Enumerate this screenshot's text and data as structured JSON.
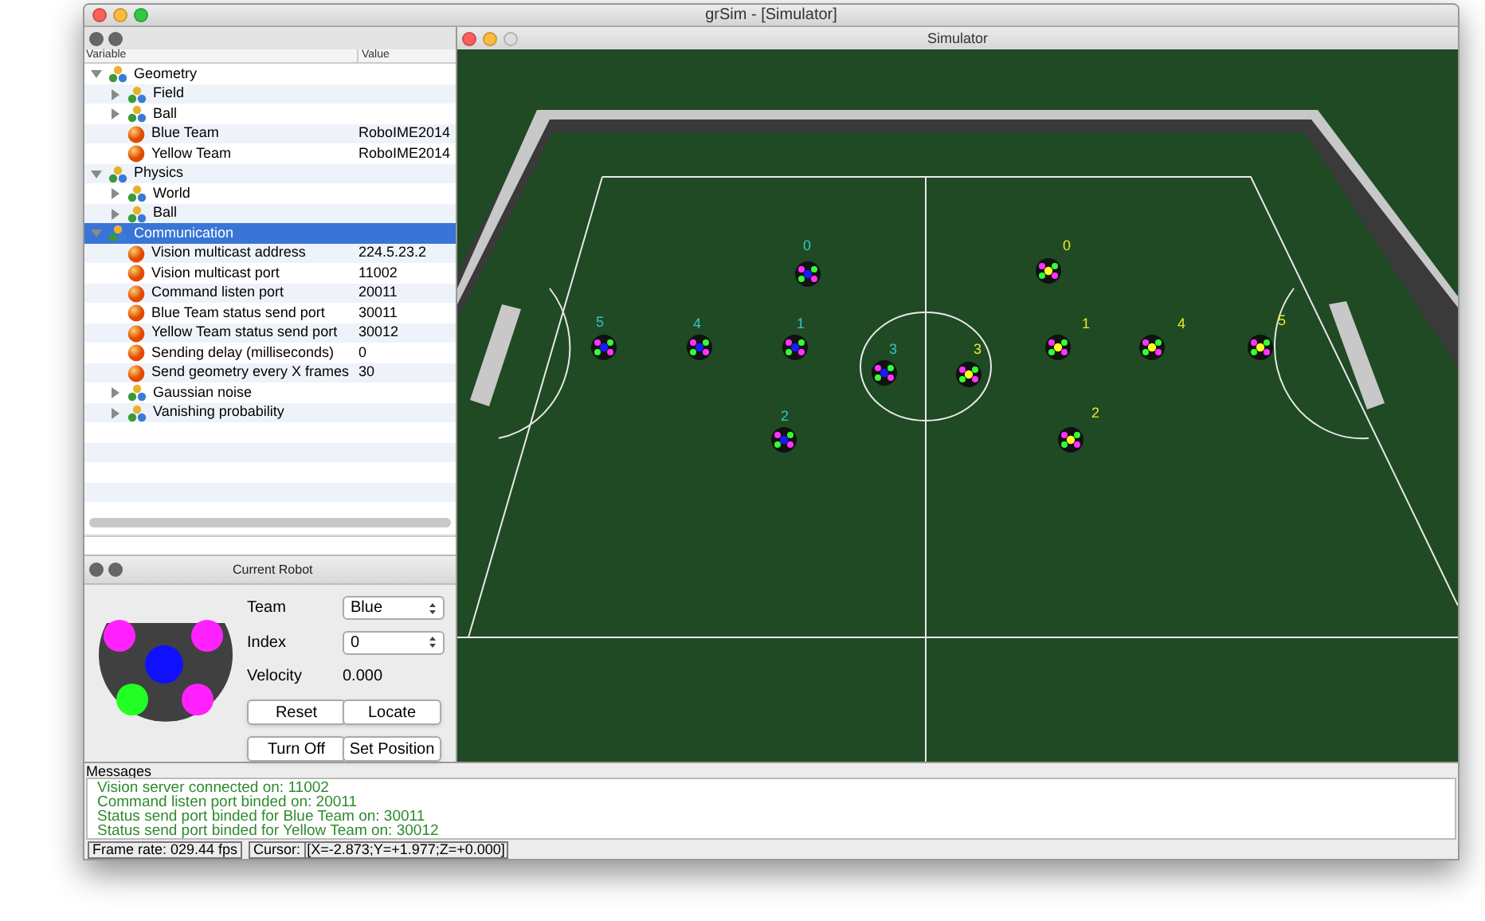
{
  "window": {
    "title": "grSim - [Simulator]"
  },
  "tree": {
    "columns": [
      "Variable",
      "Value"
    ],
    "items": [
      {
        "label": "Geometry",
        "kind": "group",
        "expanded": true,
        "selected": false,
        "children": [
          {
            "label": "Field",
            "kind": "group",
            "expanded": false,
            "selected": false
          },
          {
            "label": "Ball",
            "kind": "group",
            "expanded": false,
            "selected": false
          },
          {
            "label": "Blue Team",
            "kind": "value",
            "value": "RoboIME2014",
            "selected": false
          },
          {
            "label": "Yellow Team",
            "kind": "value",
            "value": "RoboIME2014",
            "selected": false
          }
        ]
      },
      {
        "label": "Physics",
        "kind": "group",
        "expanded": true,
        "selected": false,
        "children": [
          {
            "label": "World",
            "kind": "group",
            "expanded": false,
            "selected": false
          },
          {
            "label": "Ball",
            "kind": "group",
            "expanded": false,
            "selected": false
          }
        ]
      },
      {
        "label": "Communication",
        "kind": "group",
        "expanded": true,
        "selected": true,
        "children": [
          {
            "label": "Vision multicast address",
            "kind": "value",
            "value": "224.5.23.2",
            "selected": false
          },
          {
            "label": "Vision multicast port",
            "kind": "value",
            "value": "11002",
            "selected": false
          },
          {
            "label": "Command listen port",
            "kind": "value",
            "value": "20011",
            "selected": false
          },
          {
            "label": "Blue Team status send port",
            "kind": "value",
            "value": "30011",
            "selected": false
          },
          {
            "label": "Yellow Team status send port",
            "kind": "value",
            "value": "30012",
            "selected": false
          },
          {
            "label": "Sending delay (milliseconds)",
            "kind": "value",
            "value": "0",
            "selected": false
          },
          {
            "label": "Send geometry every X frames",
            "kind": "value",
            "value": "30",
            "selected": false
          },
          {
            "label": "Gaussian noise",
            "kind": "group",
            "expanded": false,
            "selected": false
          },
          {
            "label": "Vanishing probability",
            "kind": "group",
            "expanded": false,
            "selected": false
          }
        ]
      }
    ]
  },
  "current_robot": {
    "title": "Current Robot",
    "team_label": "Team",
    "team": "Blue",
    "index_label": "Index",
    "index": "0",
    "velocity_label": "Velocity",
    "velocity": "0.000",
    "buttons": [
      "Reset",
      "Locate",
      "Turn Off",
      "Set Position"
    ]
  },
  "simulator": {
    "title": "Simulator",
    "robots": [
      {
        "label": "0",
        "kind": "blue",
        "color": "#33c6c6"
      },
      {
        "label": "5",
        "kind": "blue",
        "color": "#33c6c6"
      },
      {
        "label": "4",
        "kind": "blue",
        "color": "#33c6c6"
      },
      {
        "label": "1",
        "kind": "blue",
        "color": "#33c6c6"
      },
      {
        "label": "3",
        "kind": "blue",
        "color": "#33c6c6"
      },
      {
        "label": "2",
        "kind": "blue",
        "color": "#33c6c6"
      },
      {
        "label": "0",
        "kind": "yellow",
        "color": "#e8e82a"
      },
      {
        "label": "3",
        "kind": "yellow",
        "color": "#e8e82a"
      },
      {
        "label": "1",
        "kind": "yellow",
        "color": "#e8e82a"
      },
      {
        "label": "4",
        "kind": "yellow",
        "color": "#e8e82a"
      },
      {
        "label": "5",
        "kind": "yellow",
        "color": "#e8e82a"
      },
      {
        "label": "2",
        "kind": "yellow",
        "color": "#e8e82a"
      }
    ]
  },
  "messages": {
    "title": "Messages",
    "lines": [
      "Vision server connected on: 11002",
      "Command listen port binded on: 20011",
      "Status send port binded for Blue Team on: 30011",
      "Status send port binded for Yellow Team on: 30012"
    ]
  },
  "status_bar": {
    "frame_rate": "Frame rate: 029.44 fps",
    "cursor_label": "Cursor:",
    "cursor": "[X=-2.873;Y=+1.977;Z=+0.000]"
  }
}
